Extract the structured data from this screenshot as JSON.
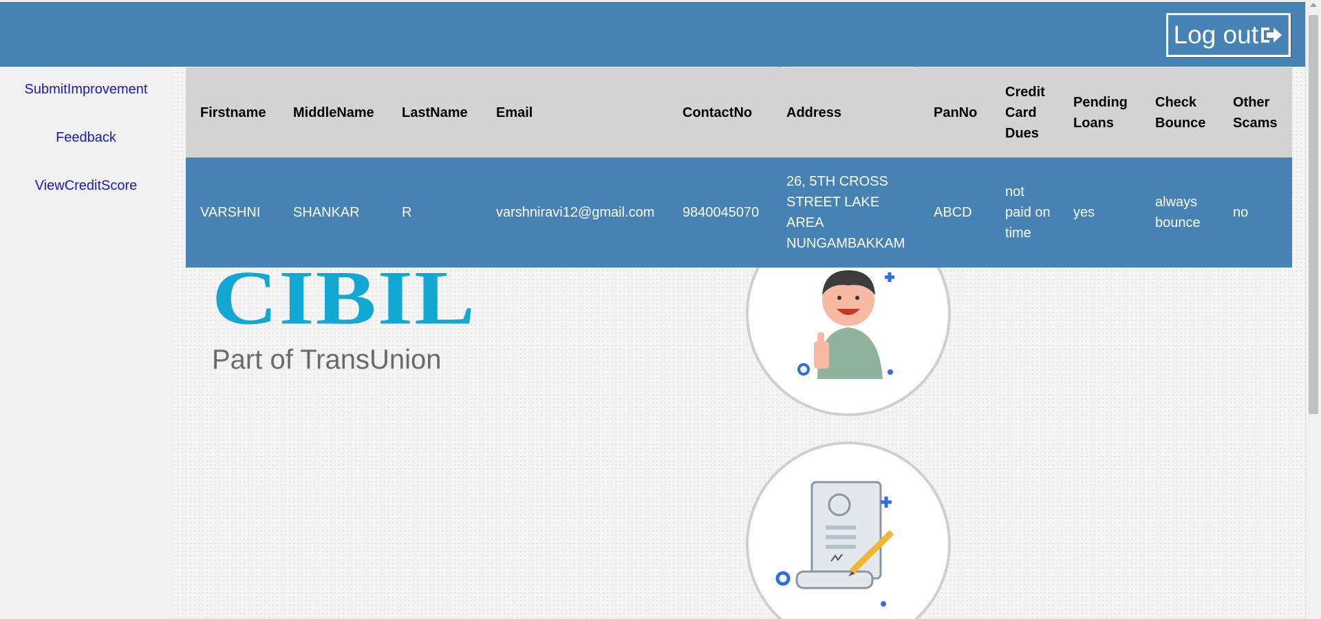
{
  "header": {
    "logout_label": "Log out",
    "logout_icon": "sign-out-icon",
    "bg_color": "#4682b4"
  },
  "sidebar": {
    "links": [
      {
        "label": "SubmitImprovement"
      },
      {
        "label": "Feedback"
      },
      {
        "label": "ViewCreditScore"
      }
    ],
    "link_color": "#1a1ab8"
  },
  "table": {
    "headers": [
      "Firstname",
      "MiddleName",
      "LastName",
      "Email",
      "ContactNo",
      "Address",
      "PanNo",
      "Credit Card Dues",
      "Pending Loans",
      "Check Bounce",
      "Other Scams"
    ],
    "rows": [
      [
        "VARSHNI",
        "SHANKAR",
        "R",
        "varshniravi12@gmail.com",
        "9840045070",
        "26, 5TH CROSS STREET LAKE AREA NUNGAMBAKKAM",
        "ABCD",
        "not paid on time",
        "yes",
        "always bounce",
        "no"
      ]
    ],
    "header_bg": "#d3d3d3",
    "row_bg": "#4682b4"
  },
  "logo": {
    "title": "CIBIL",
    "subtitle": "Part of TransUnion",
    "color": "#13a8d3"
  },
  "illustrations": [
    {
      "name": "happy-person-thumbs-up-illustration"
    },
    {
      "name": "document-signing-illustration"
    }
  ]
}
